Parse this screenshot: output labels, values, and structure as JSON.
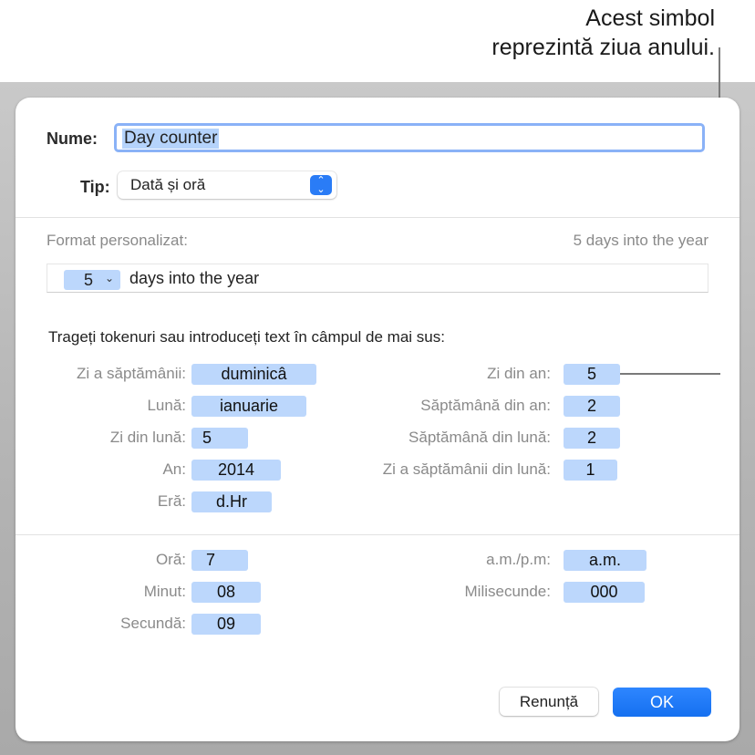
{
  "callout": {
    "line1": "Acest simbol",
    "line2": "reprezintă ziua anului."
  },
  "dialog": {
    "name_label": "Nume:",
    "name_value": "Day counter",
    "type_label": "Tip:",
    "type_value": "Dată și oră",
    "format_label": "Format personalizat:",
    "format_preview": "5 days into the year",
    "format_token_value": "5",
    "format_token_chevron": "⌄",
    "format_text": "days into the year",
    "instructions": "Trageți tokenuri sau introduceți text în câmpul de mai sus:",
    "date_tokens_left": [
      {
        "label": "Zi a săptămânii:",
        "value": "duminicâ"
      },
      {
        "label": "Lună:",
        "value": "ianuarie"
      },
      {
        "label": "Zi din lună:",
        "value": "5"
      },
      {
        "label": "An:",
        "value": "2014"
      },
      {
        "label": "Eră:",
        "value": "d.Hr"
      }
    ],
    "date_tokens_right": [
      {
        "label": "Zi din an:",
        "value": "5"
      },
      {
        "label": "Săptămână din an:",
        "value": "2"
      },
      {
        "label": "Săptămână din lună:",
        "value": "2"
      },
      {
        "label": "Zi a săptămânii din lună:",
        "value": "1"
      }
    ],
    "time_tokens_left": [
      {
        "label": "Oră:",
        "value": "7"
      },
      {
        "label": "Minut:",
        "value": "08"
      },
      {
        "label": "Secundă:",
        "value": "09"
      }
    ],
    "time_tokens_right": [
      {
        "label": "a.m./p.m:",
        "value": "a.m."
      },
      {
        "label": "Milisecunde:",
        "value": "000"
      }
    ],
    "cancel_label": "Renunță",
    "ok_label": "OK"
  },
  "colors": {
    "accent": "#2a7cf6",
    "token_bg": "#bcd7fc",
    "focus_ring": "#8ab2f7"
  }
}
